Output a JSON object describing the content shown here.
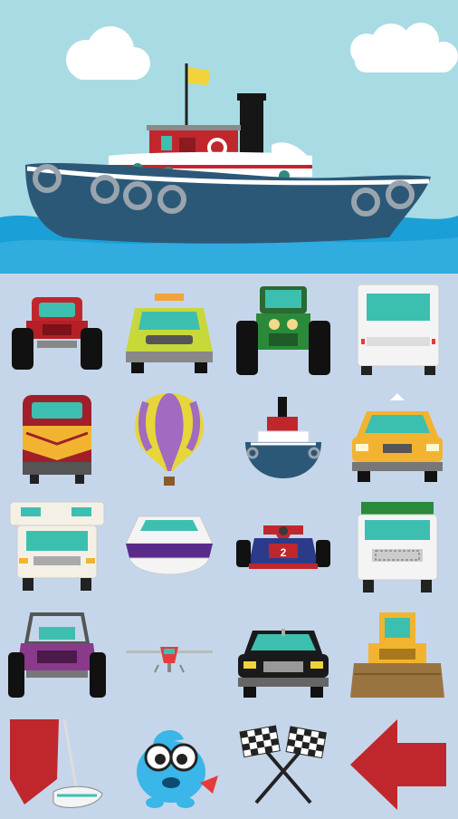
{
  "app": {
    "hero": {
      "subject": "tugboat",
      "icon": "tugboat-scene-icon"
    },
    "grid": {
      "rows": [
        [
          "monster-truck-icon",
          "taxi-front-icon",
          "tractor-icon",
          "delivery-truck-icon"
        ],
        [
          "train-locomotive-icon",
          "hot-air-balloon-icon",
          "tugboat-icon",
          "yellow-taxi-icon"
        ],
        [
          "rv-camper-icon",
          "speedboat-icon",
          "race-car-icon",
          "garbage-truck-icon"
        ],
        [
          "dune-buggy-icon",
          "airplane-icon",
          "limousine-icon",
          "bulldozer-icon"
        ],
        [
          "sailboat-icon",
          "mascot-character-icon",
          "checkered-flags-icon",
          "back-arrow-icon"
        ]
      ]
    }
  },
  "colors": {
    "sky": "#a8dbe4",
    "sea": "#1aa0d6",
    "grid_bg": "#c5d6ea",
    "boat_hull": "#2c5878",
    "accent_red": "#c0272d",
    "accent_yellow": "#f2d43a"
  }
}
